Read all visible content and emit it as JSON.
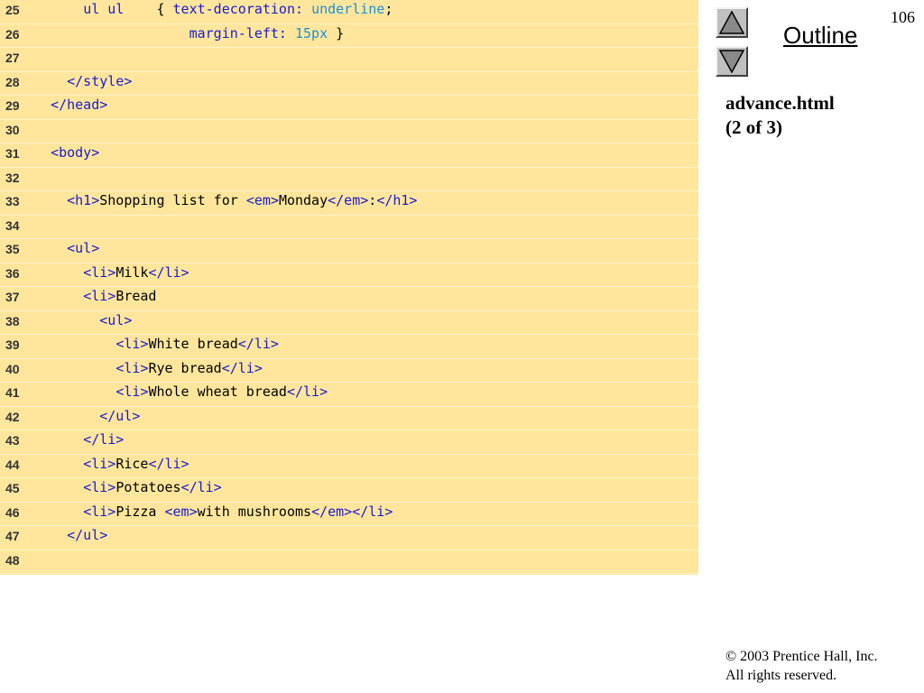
{
  "page_number": "106",
  "outline_label": "Outline",
  "slide_title": [
    "advance.html",
    "(2 of 3)"
  ],
  "footer": {
    "copyright": "© 2003 Prentice Hall, Inc.",
    "rights": "All rights reserved."
  },
  "colors": {
    "code_background": "#ffe69c",
    "markup": "#1a1ad0",
    "value": "#1e8fd6",
    "text": "#000000"
  },
  "icons": {
    "nav_up": "triangle-up-icon",
    "nav_down": "triangle-down-icon"
  },
  "code_lines": [
    {
      "num": "25",
      "tokens": [
        {
          "t": "      ",
          "k": "text"
        },
        {
          "t": "ul ul",
          "k": "markup"
        },
        {
          "t": "    { ",
          "k": "text"
        },
        {
          "t": "text-decoration:",
          "k": "markup"
        },
        {
          "t": " ",
          "k": "text"
        },
        {
          "t": "underline",
          "k": "value"
        },
        {
          "t": ";",
          "k": "text"
        }
      ]
    },
    {
      "num": "26",
      "tokens": [
        {
          "t": "                   ",
          "k": "text"
        },
        {
          "t": "margin-left:",
          "k": "markup"
        },
        {
          "t": " ",
          "k": "text"
        },
        {
          "t": "15px",
          "k": "value"
        },
        {
          "t": " }",
          "k": "text"
        }
      ]
    },
    {
      "num": "27",
      "tokens": []
    },
    {
      "num": "28",
      "tokens": [
        {
          "t": "    ",
          "k": "text"
        },
        {
          "t": "</style>",
          "k": "markup"
        }
      ]
    },
    {
      "num": "29",
      "tokens": [
        {
          "t": "  ",
          "k": "text"
        },
        {
          "t": "</head>",
          "k": "markup"
        }
      ]
    },
    {
      "num": "30",
      "tokens": []
    },
    {
      "num": "31",
      "tokens": [
        {
          "t": "  ",
          "k": "text"
        },
        {
          "t": "<body>",
          "k": "markup"
        }
      ]
    },
    {
      "num": "32",
      "tokens": []
    },
    {
      "num": "33",
      "tokens": [
        {
          "t": "    ",
          "k": "text"
        },
        {
          "t": "<h1>",
          "k": "markup"
        },
        {
          "t": "Shopping list for ",
          "k": "text"
        },
        {
          "t": "<em>",
          "k": "markup"
        },
        {
          "t": "Monday",
          "k": "text"
        },
        {
          "t": "</em>",
          "k": "markup"
        },
        {
          "t": ":",
          "k": "text"
        },
        {
          "t": "</h1>",
          "k": "markup"
        }
      ]
    },
    {
      "num": "34",
      "tokens": []
    },
    {
      "num": "35",
      "tokens": [
        {
          "t": "    ",
          "k": "text"
        },
        {
          "t": "<ul>",
          "k": "markup"
        }
      ]
    },
    {
      "num": "36",
      "tokens": [
        {
          "t": "      ",
          "k": "text"
        },
        {
          "t": "<li>",
          "k": "markup"
        },
        {
          "t": "Milk",
          "k": "text"
        },
        {
          "t": "</li>",
          "k": "markup"
        }
      ]
    },
    {
      "num": "37",
      "tokens": [
        {
          "t": "      ",
          "k": "text"
        },
        {
          "t": "<li>",
          "k": "markup"
        },
        {
          "t": "Bread",
          "k": "text"
        }
      ]
    },
    {
      "num": "38",
      "tokens": [
        {
          "t": "        ",
          "k": "text"
        },
        {
          "t": "<ul>",
          "k": "markup"
        }
      ]
    },
    {
      "num": "39",
      "tokens": [
        {
          "t": "          ",
          "k": "text"
        },
        {
          "t": "<li>",
          "k": "markup"
        },
        {
          "t": "White bread",
          "k": "text"
        },
        {
          "t": "</li>",
          "k": "markup"
        }
      ]
    },
    {
      "num": "40",
      "tokens": [
        {
          "t": "          ",
          "k": "text"
        },
        {
          "t": "<li>",
          "k": "markup"
        },
        {
          "t": "Rye bread",
          "k": "text"
        },
        {
          "t": "</li>",
          "k": "markup"
        }
      ]
    },
    {
      "num": "41",
      "tokens": [
        {
          "t": "          ",
          "k": "text"
        },
        {
          "t": "<li>",
          "k": "markup"
        },
        {
          "t": "Whole wheat bread",
          "k": "text"
        },
        {
          "t": "</li>",
          "k": "markup"
        }
      ]
    },
    {
      "num": "42",
      "tokens": [
        {
          "t": "        ",
          "k": "text"
        },
        {
          "t": "</ul>",
          "k": "markup"
        }
      ]
    },
    {
      "num": "43",
      "tokens": [
        {
          "t": "      ",
          "k": "text"
        },
        {
          "t": "</li>",
          "k": "markup"
        }
      ]
    },
    {
      "num": "44",
      "tokens": [
        {
          "t": "      ",
          "k": "text"
        },
        {
          "t": "<li>",
          "k": "markup"
        },
        {
          "t": "Rice",
          "k": "text"
        },
        {
          "t": "</li>",
          "k": "markup"
        }
      ]
    },
    {
      "num": "45",
      "tokens": [
        {
          "t": "      ",
          "k": "text"
        },
        {
          "t": "<li>",
          "k": "markup"
        },
        {
          "t": "Potatoes",
          "k": "text"
        },
        {
          "t": "</li>",
          "k": "markup"
        }
      ]
    },
    {
      "num": "46",
      "tokens": [
        {
          "t": "      ",
          "k": "text"
        },
        {
          "t": "<li>",
          "k": "markup"
        },
        {
          "t": "Pizza ",
          "k": "text"
        },
        {
          "t": "<em>",
          "k": "markup"
        },
        {
          "t": "with mushrooms",
          "k": "text"
        },
        {
          "t": "</em>",
          "k": "markup"
        },
        {
          "t": "</li>",
          "k": "markup"
        }
      ]
    },
    {
      "num": "47",
      "tokens": [
        {
          "t": "    ",
          "k": "text"
        },
        {
          "t": "</ul>",
          "k": "markup"
        }
      ]
    },
    {
      "num": "48",
      "tokens": []
    }
  ]
}
